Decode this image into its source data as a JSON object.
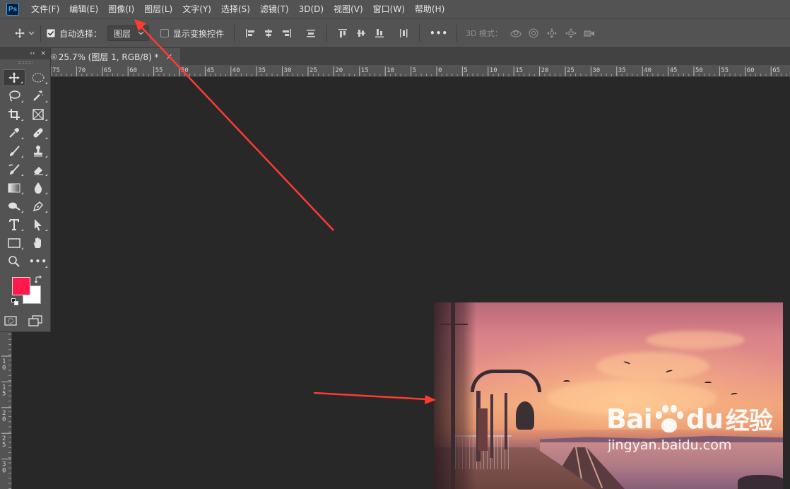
{
  "app": {
    "logo": "Ps"
  },
  "menu": [
    "文件(F)",
    "编辑(E)",
    "图像(I)",
    "图层(L)",
    "文字(Y)",
    "选择(S)",
    "滤镜(T)",
    "3D(D)",
    "视图(V)",
    "窗口(W)",
    "帮助(H)"
  ],
  "options": {
    "auto_select_label": "自动选择：",
    "auto_select_checked": true,
    "auto_select_target": "图层",
    "show_transform_label": "显示变换控件",
    "show_transform_checked": false,
    "mode_3d_label": "3D 模式：",
    "more_label": "•••"
  },
  "document": {
    "tab_title": "25.7% (图层 1, RGB/8) *",
    "tab_prefix": "◎",
    "close": "×"
  },
  "ruler": {
    "top_labels": [
      "75",
      "70",
      "65",
      "60",
      "55",
      "50",
      "45",
      "40",
      "35",
      "30",
      "25",
      "20",
      "15",
      "10",
      "5",
      "0",
      "5",
      "10",
      "15",
      "20",
      "25",
      "30",
      "35",
      "40",
      "45",
      "50",
      "55",
      "60",
      "65"
    ],
    "left_labels": [
      "1\n0",
      "1\n5",
      "2\n0",
      "2\n5",
      "3\n0"
    ]
  },
  "toolbox": {
    "header_collapse": "‹‹",
    "header_close": "×",
    "more_tools": "•••",
    "foreground_color": "#ff1a4b",
    "background_color": "#ffffff"
  },
  "watermark": {
    "brand_left": "Bai",
    "brand_right": "du",
    "brand_cn": "经验",
    "url": "jingyan.baidu.com"
  },
  "colors": {
    "chrome": "#535353",
    "canvas": "#282828",
    "annotation_arrow": "#ff3b30"
  }
}
